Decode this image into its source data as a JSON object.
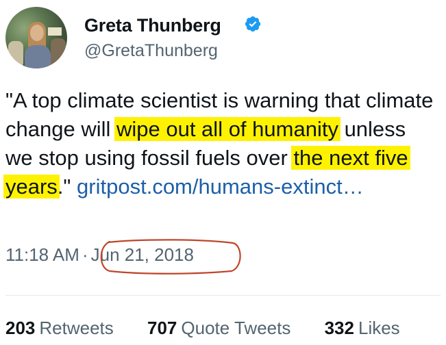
{
  "author": {
    "display_name": "Greta Thunberg",
    "handle": "@GretaThunberg",
    "verified": true
  },
  "tweet": {
    "segments": [
      {
        "text": "\"A top climate scientist is warning that climate change will ",
        "highlight": false
      },
      {
        "text": "wipe out all of humanity",
        "highlight": true
      },
      {
        "text": " unless we stop using fossil fuels over ",
        "highlight": false
      },
      {
        "text": "the next five years",
        "highlight": true
      },
      {
        "text": ".\" ",
        "highlight": false
      }
    ],
    "link": "gritpost.com/humans-extinct…"
  },
  "meta": {
    "time": "11:18 AM",
    "separator": "·",
    "date": "Jun 21, 2018"
  },
  "stats": {
    "retweets_count": "203",
    "retweets_label": "Retweets",
    "quotes_count": "707",
    "quotes_label": "Quote Tweets",
    "likes_count": "332",
    "likes_label": "Likes"
  },
  "colors": {
    "highlight": "#fff200",
    "link": "#1d5fa8",
    "verified": "#1d9bf0",
    "date_circle": "#c0452a"
  }
}
